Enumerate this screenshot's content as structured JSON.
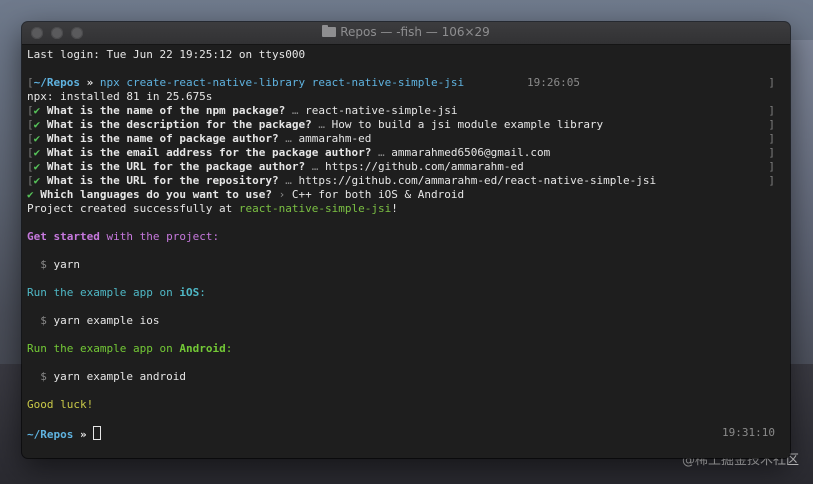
{
  "window": {
    "title": "Repos — -fish — 106×29"
  },
  "watermark": "@稀土掘金技术社区",
  "terminal": {
    "last_login": "Last login: Tue Jun 22 19:25:12 on ttys000",
    "prompt1": {
      "path": "~/Repos",
      "arrow": "»",
      "command": "npx create-react-native-library react-native-simple-jsi",
      "time": "19:26:05"
    },
    "npx_installed": "npx: installed 81 in 25.675s",
    "questions": [
      {
        "check": "✔",
        "q": "What is the name of the npm package?",
        "sep": "…",
        "a": "react-native-simple-jsi"
      },
      {
        "check": "✔",
        "q": "What is the description for the package?",
        "sep": "…",
        "a": "How to build a jsi module example library"
      },
      {
        "check": "✔",
        "q": "What is the name of package author?",
        "sep": "…",
        "a": "ammarahm-ed"
      },
      {
        "check": "✔",
        "q": "What is the email address for the package author?",
        "sep": "…",
        "a": "ammarahmed6506@gmail.com"
      },
      {
        "check": "✔",
        "q": "What is the URL for the package author?",
        "sep": "…",
        "a": "https://github.com/ammarahm-ed"
      },
      {
        "check": "✔",
        "q": "What is the URL for the repository?",
        "sep": "…",
        "a": "https://github.com/ammarahm-ed/react-native-simple-jsi"
      },
      {
        "check": "✔",
        "q": "Which languages do you want to use?",
        "sep": "›",
        "a": "C++ for both iOS & Android"
      }
    ],
    "created": {
      "prefix": "Project created successfully at ",
      "name": "react-native-simple-jsi",
      "suffix": "!"
    },
    "get_started": {
      "bold": "Get started",
      "rest": " with the project:"
    },
    "cmd_yarn": "yarn",
    "ios_heading": {
      "pre": "Run the example app on ",
      "bold": "iOS",
      "post": ":"
    },
    "cmd_ios": "yarn example ios",
    "android_heading": {
      "pre": "Run the example app on ",
      "bold": "Android",
      "post": ":"
    },
    "cmd_android": "yarn example android",
    "dollar": "$",
    "good_luck": "Good luck!",
    "prompt2": {
      "path": "~/Repos",
      "arrow": "»",
      "time": "19:31:10"
    }
  },
  "colors": {
    "prompt": "#5fb3e0",
    "check": "#57c45a",
    "magenta": "#c678dd",
    "cyan": "#4fb8c6",
    "green": "#73c936",
    "yellow": "#c9c948"
  }
}
